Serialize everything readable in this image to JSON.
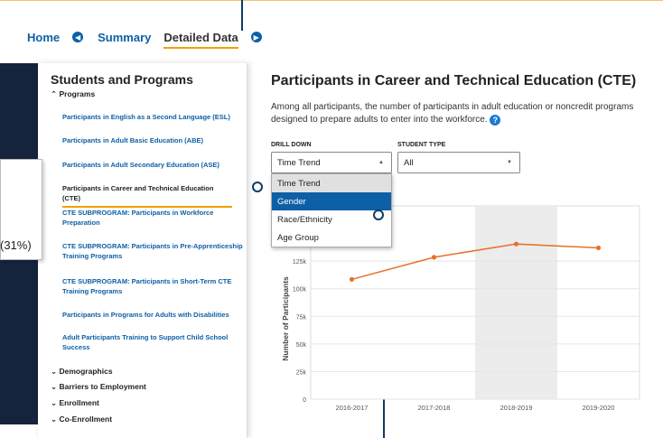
{
  "nav": {
    "tabs": [
      {
        "label": "Home"
      },
      {
        "label": "Summary"
      },
      {
        "label": "Detailed Data",
        "active": true
      }
    ]
  },
  "sidebar": {
    "title": "Students and Programs",
    "programs_label": "Programs",
    "items": [
      {
        "label": "Participants in English as a Second Language (ESL)"
      },
      {
        "label": "Participants in Adult Basic Education (ABE)"
      },
      {
        "label": "Participants in Adult Secondary Education (ASE)"
      },
      {
        "label": "Participants in Career and Technical Education (CTE)",
        "active": true
      },
      {
        "label": "CTE SUBPROGRAM: Participants in Workforce Preparation"
      },
      {
        "label": "CTE SUBPROGRAM: Participants in Pre-Apprenticeship Training Programs"
      },
      {
        "label": "CTE SUBPROGRAM: Participants in Short-Term CTE Training Programs"
      },
      {
        "label": "Participants in Programs for Adults with Disabilities"
      },
      {
        "label": "Adult Participants Training to Support Child School Success"
      }
    ],
    "groups": [
      "Demographics",
      "Barriers to Employment",
      "Enrollment",
      "Co-Enrollment"
    ]
  },
  "popup": {
    "text": "(31%)"
  },
  "main": {
    "title": "Participants in Career and Technical Education (CTE)",
    "description": "Among all participants, the number of participants in adult education or noncredit programs designed to prepare adults to enter into the workforce."
  },
  "filters": {
    "drill_down": {
      "label": "DRILL DOWN",
      "value": "Time Trend",
      "options": [
        "Time Trend",
        "Gender",
        "Race/Ethnicity",
        "Age Group"
      ],
      "highlighted": "Gender"
    },
    "student_type": {
      "label": "STUDENT TYPE",
      "value": "All"
    }
  },
  "colors": {
    "accent": "#f0a100",
    "link": "#0d5fa6",
    "line": "#e8702a",
    "dark": "#16233d"
  },
  "chart_data": {
    "type": "line",
    "title": "",
    "xlabel": "",
    "ylabel": "Number of Participants",
    "categories": [
      "2016-2017",
      "2017-2018",
      "2018-2019",
      "2019-2020"
    ],
    "series": [
      {
        "values": [
          108500,
          128500,
          140500,
          137000
        ]
      }
    ],
    "ylim": [
      0,
      175000
    ],
    "yticks": [
      0,
      25000,
      50000,
      75000,
      100000,
      125000
    ],
    "ytick_labels": [
      "0",
      "25k",
      "50k",
      "75k",
      "100k",
      "125k"
    ],
    "highlight_category": "2018-2019",
    "grid": true
  }
}
